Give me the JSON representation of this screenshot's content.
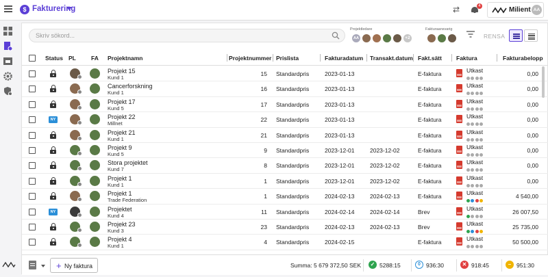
{
  "app": {
    "title": "Fakturering",
    "logo_letter": "$",
    "user": "Milient",
    "user_initials": "AA",
    "notifications": "4"
  },
  "search": {
    "placeholder": "Skriv sökord..."
  },
  "filters": {
    "projektledare_label": "Projektledare",
    "extra_count": "+2",
    "faktura_label": "Fakturaansvarig",
    "pl_initials": "AA",
    "clear": "RENSA"
  },
  "columns": [
    "Status",
    "PL",
    "FA",
    "Projektnamn",
    "Projektnummer",
    "Prislista",
    "Fakturadatum",
    "Transakt.datum",
    "Fakt.sätt",
    "Faktura",
    "Fakturabelopp"
  ],
  "rows": [
    {
      "status": "lock",
      "name": "Projekt 15",
      "kund": "Kund 1",
      "nr": "15",
      "prislista": "Standardpris",
      "fdatum": "2023-01-13",
      "tdatum": "",
      "satt": "E-faktura",
      "faktura": "Utkast",
      "dots": [
        "#aaa",
        "#aaa",
        "#aaa",
        "#aaa"
      ],
      "belopp": "0,00",
      "pl": "#6b5a48",
      "fa": "#5a7a46"
    },
    {
      "status": "lock",
      "name": "Cancerforskning",
      "kund": "Kund 1",
      "nr": "16",
      "prislista": "Standardpris",
      "fdatum": "2023-01-13",
      "tdatum": "",
      "satt": "E-faktura",
      "faktura": "Utkast",
      "dots": [
        "#aaa",
        "#aaa",
        "#aaa",
        "#aaa"
      ],
      "belopp": "0,00",
      "pl": "#8a6a50",
      "fa": "#5a7a46"
    },
    {
      "status": "lock",
      "name": "Projekt 17",
      "kund": "Kund 5",
      "nr": "17",
      "prislista": "Standardpris",
      "fdatum": "2023-01-13",
      "tdatum": "",
      "satt": "E-faktura",
      "faktura": "Utkast",
      "dots": [
        "#aaa",
        "#aaa",
        "#aaa",
        "#aaa"
      ],
      "belopp": "0,00",
      "pl": "#8a6a50",
      "fa": "#5a7a46"
    },
    {
      "status": "ny",
      "name": "Projekt 22",
      "kund": "Millnet",
      "nr": "22",
      "prislista": "Standardpris",
      "fdatum": "2023-01-13",
      "tdatum": "",
      "satt": "E-faktura",
      "faktura": "Utkast",
      "dots": [
        "#aaa",
        "#aaa",
        "#aaa",
        "#aaa"
      ],
      "belopp": "0,00",
      "pl": "#8a6a50",
      "fa": "#5a7a46"
    },
    {
      "status": "lock",
      "name": "Projekt 21",
      "kund": "Kund 1",
      "nr": "21",
      "prislista": "Standardpris",
      "fdatum": "2023-01-13",
      "tdatum": "",
      "satt": "E-faktura",
      "faktura": "Utkast",
      "dots": [
        "#aaa",
        "#aaa",
        "#aaa",
        "#aaa"
      ],
      "belopp": "0,00",
      "pl": "#8a6a50",
      "fa": "#5a7a46"
    },
    {
      "status": "lock",
      "name": "Projekt 9",
      "kund": "Kund 5",
      "nr": "9",
      "prislista": "Standardpris",
      "fdatum": "2023-12-01",
      "tdatum": "2023-12-02",
      "satt": "E-faktura",
      "faktura": "Utkast",
      "dots": [
        "#aaa",
        "#aaa",
        "#aaa",
        "#aaa"
      ],
      "belopp": "0,00",
      "pl": "#5a7a46",
      "fa": "#5a7a46"
    },
    {
      "status": "lock",
      "name": "Stora projektet",
      "kund": "Kund 7",
      "nr": "8",
      "prislista": "Standardpris",
      "fdatum": "2023-12-01",
      "tdatum": "2023-12-02",
      "satt": "E-faktura",
      "faktura": "Utkast",
      "dots": [
        "#aaa",
        "#aaa",
        "#aaa",
        "#aaa"
      ],
      "belopp": "0,00",
      "pl": "#5a7a46",
      "fa": "#5a7a46"
    },
    {
      "status": "lock",
      "name": "Projekt 1",
      "kund": "Kund 1",
      "nr": "1",
      "prislista": "Standardpris",
      "fdatum": "2023-12-01",
      "tdatum": "2023-12-02",
      "satt": "E-faktura",
      "faktura": "Utkast",
      "dots": [
        "#aaa",
        "#aaa",
        "#aaa",
        "#aaa"
      ],
      "belopp": "0,00",
      "pl": "#5a7a46",
      "fa": "#5a7a46"
    },
    {
      "status": "lock",
      "name": "Projekt 1",
      "kund": "Trade Federation",
      "nr": "1",
      "prislista": "Standardpris",
      "fdatum": "2024-02-13",
      "tdatum": "2024-02-13",
      "satt": "E-faktura",
      "faktura": "Utkast",
      "dots": [
        "#2ea44f",
        "#2b8fd8",
        "#e04040",
        "#f0b400"
      ],
      "belopp": "4 540,00",
      "pl": "#8a6a50",
      "fa": "#5a7a46"
    },
    {
      "status": "ny",
      "name": "Projektet",
      "kund": "Kund 4",
      "nr": "11",
      "prislista": "Standardpris",
      "fdatum": "2024-02-14",
      "tdatum": "2024-02-14",
      "satt": "Brev",
      "faktura": "Utkast",
      "dots": [
        "#2ea44f",
        "#aaa",
        "#aaa",
        "#aaa"
      ],
      "belopp": "26 007,50",
      "pl": "#3a3a3a",
      "fa": "#5a7a46"
    },
    {
      "status": "lock",
      "name": "Projekt 23",
      "kund": "Kund 3",
      "nr": "23",
      "prislista": "Standardpris",
      "fdatum": "2024-02-13",
      "tdatum": "2024-02-13",
      "satt": "Brev",
      "faktura": "Utkast",
      "dots": [
        "#2ea44f",
        "#2b8fd8",
        "#e04040",
        "#f0b400"
      ],
      "belopp": "25 735,00",
      "pl": "#5a7a46",
      "fa": "#5a7a46"
    },
    {
      "status": "lock",
      "name": "Projekt 4",
      "kund": "Kund 1",
      "nr": "4",
      "prislista": "Standardpris",
      "fdatum": "2024-02-15",
      "tdatum": "",
      "satt": "E-faktura",
      "faktura": "Utkast",
      "dots": [
        "#aaa",
        "#aaa",
        "#aaa",
        "#aaa"
      ],
      "belopp": "50 500,00",
      "pl": "#5a7a46",
      "fa": "#5a7a46"
    }
  ],
  "footer": {
    "new_invoice": "Ny faktura",
    "summa": "Summa:   5 679 372,50 SEK",
    "s_green": "5288:15",
    "s_blue": "936:30",
    "s_red": "918:45",
    "s_yellow": "951:30"
  },
  "colors": {
    "accent": "#5b3fd6",
    "ny": "#2b8fd8",
    "pdf": "#d53a2e"
  }
}
